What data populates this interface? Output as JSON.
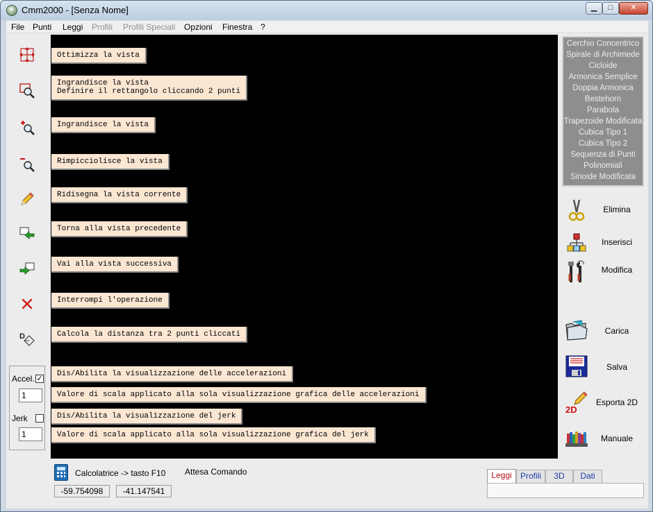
{
  "window": {
    "title": "Cmm2000 - [Senza Nome]",
    "minimize": "▁",
    "maximize": "□",
    "close": "✕"
  },
  "menu": [
    {
      "label": "File",
      "enabled": true
    },
    {
      "label": "Punti",
      "enabled": true
    },
    {
      "label": "Leggi",
      "enabled": true
    },
    {
      "label": "Profili",
      "enabled": false
    },
    {
      "label": "Profili Speciali",
      "enabled": false
    },
    {
      "label": "Opzioni",
      "enabled": true
    },
    {
      "label": "Finestra",
      "enabled": true
    },
    {
      "label": "?",
      "enabled": true
    }
  ],
  "toolbar": {
    "icons": [
      "fit-view-icon",
      "zoom-rectangle-icon",
      "zoom-in-icon",
      "zoom-out-icon",
      "redraw-pencil-icon",
      "previous-view-icon",
      "next-view-icon",
      "stop-icon",
      "measure-distance-icon"
    ]
  },
  "tooltips": [
    "Ottimizza la vista",
    "Ingrandisce la vista\nDefinire il rettangolo cliccando 2 punti",
    "Ingrandisce la vista",
    "Rimpicciolisce la vista",
    "Ridisegna la vista corrente",
    "Torna alla vista precedente",
    "Vai alla vista successiva",
    "Interrompi l'operazione",
    "Calcola la distanza tra 2 punti cliccati",
    "Dis/Abilita la visualizzazione delle accelerazioni",
    "Valore di scala applicato alla sola visualizzazione grafica delle accelerazioni",
    "Dis/Abilita la visualizzazione del jerk",
    "Valore di scala applicato alla sola visualizzazione grafica del jerk"
  ],
  "checks": {
    "accel": {
      "label": "Accel.",
      "checked": true,
      "check_mark": "✓",
      "scale": "1"
    },
    "jerk": {
      "label": "Jerk",
      "checked": false,
      "check_mark": "",
      "scale": "1"
    }
  },
  "profiles": [
    "Cerchio Concentrico",
    "Spirale di Archimede",
    "Cicloide",
    "Armonica Semplice",
    "Doppia Armonica",
    "Bestehorn",
    "Parabola",
    "Trapezoide Modificata",
    "Cubica Tipo 1",
    "Cubica Tipo 2",
    "Sequenza di Punti",
    "Polinomiali",
    "Sinoide Modificata"
  ],
  "actions": {
    "elimina": {
      "label": "Elimina",
      "icon": "scissors-icon"
    },
    "inserisci": {
      "label": "Inserisci",
      "icon": "insert-hierarchy-icon"
    },
    "modifica": {
      "label": "Modifica",
      "icon": "tools-icon"
    },
    "carica": {
      "label": "Carica",
      "icon": "open-folder-icon"
    },
    "salva": {
      "label": "Salva",
      "icon": "floppy-disk-icon"
    },
    "esporta": {
      "label": "Esporta 2D",
      "icon": "export-2d-icon",
      "badge": "2D"
    },
    "manuale": {
      "label": "Manuale",
      "icon": "books-icon"
    }
  },
  "status": {
    "calc_label": "Calcolatrice -> tasto F10",
    "message": "Attesa Comando",
    "x": "-59.754098",
    "y": "-41.147541"
  },
  "tabs": [
    {
      "label": "Leggi",
      "active": true
    },
    {
      "label": "Profili",
      "active": false
    },
    {
      "label": "3D",
      "active": false
    },
    {
      "label": "Dati",
      "active": false
    }
  ]
}
